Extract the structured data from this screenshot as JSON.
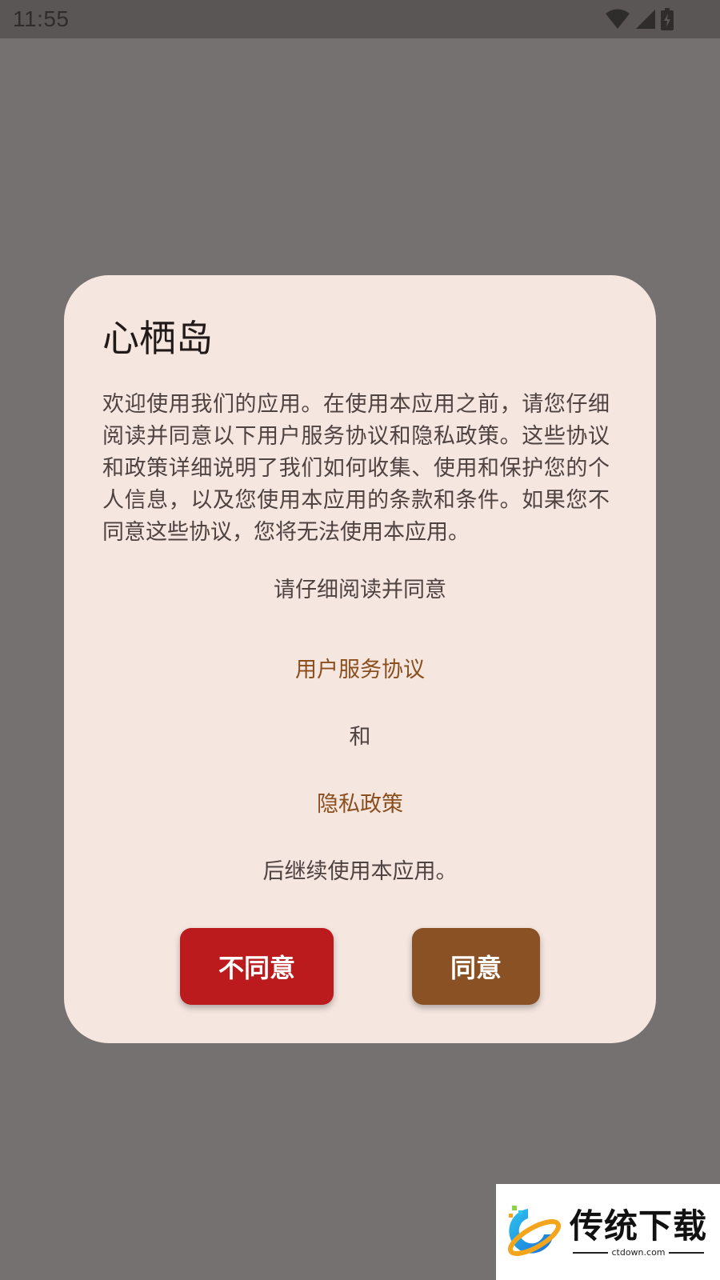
{
  "status_bar": {
    "time": "11:55",
    "icons": [
      "wifi-icon",
      "signal-icon",
      "battery-charging-icon"
    ]
  },
  "dialog": {
    "title": "心栖岛",
    "body": "欢迎使用我们的应用。在使用本应用之前，请您仔细阅读并同意以下用户服务协议和隐私政策。这些协议和政策详细说明了我们如何收集、使用和保护您的个人信息，以及您使用本应用的条款和条件。如果您不同意这些协议，您将无法使用本应用。",
    "please_read": "请仔细阅读并同意",
    "terms_link": "用户服务协议",
    "and": "和",
    "privacy_link": "隐私政策",
    "after": "后继续使用本应用。",
    "disagree_label": "不同意",
    "agree_label": "同意"
  },
  "watermark": {
    "title": "传统下载",
    "subtitle": "ctdown.com"
  },
  "colors": {
    "scrim": "#757170",
    "dialog_bg": "#f5e6e0",
    "link": "#8b4f1d",
    "disagree": "#bb1b1c",
    "agree": "#8a5124"
  }
}
